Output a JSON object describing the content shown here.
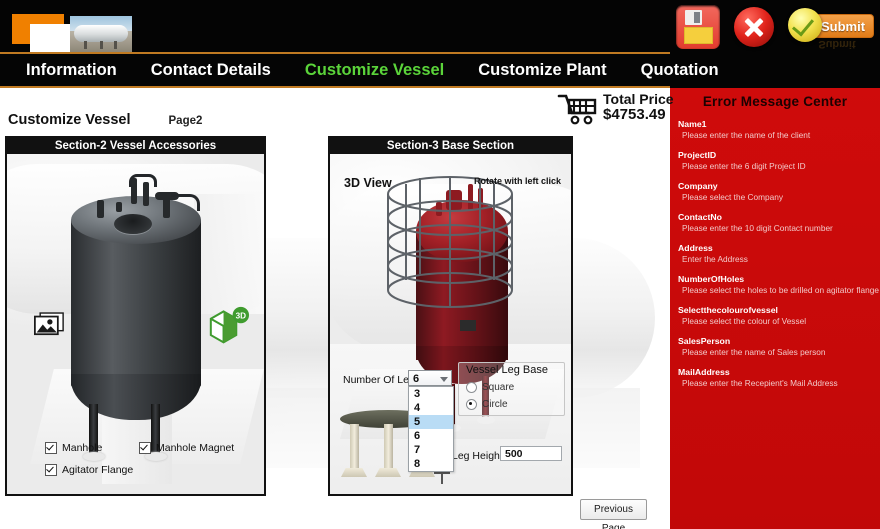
{
  "app": {
    "logo_alt": "vessel-company-logo"
  },
  "toolbar": {
    "save_label": "Save",
    "close_label": "Close",
    "submit_label": "Submit"
  },
  "nav": {
    "items": [
      {
        "label": "Information",
        "active": false
      },
      {
        "label": "Contact Details",
        "active": false
      },
      {
        "label": "Customize Vessel",
        "active": true
      },
      {
        "label": "Customize Plant",
        "active": false
      },
      {
        "label": "Quotation",
        "active": false
      }
    ],
    "active_color": "#5bd43a"
  },
  "page": {
    "title": "Customize Vessel",
    "page_number": "Page2"
  },
  "cart": {
    "label": "Total Price",
    "value": "$4753.49"
  },
  "panel_accessories": {
    "header": "Section-2 Vessel Accessories",
    "image_icon": "image-icon",
    "three_d_icon": "3D",
    "checkboxes": [
      {
        "label": "Manhole",
        "checked": true
      },
      {
        "label": "Manhole Magnet",
        "checked": true
      },
      {
        "label": "Agitator Flange",
        "checked": true
      }
    ]
  },
  "panel_base": {
    "header": "Section-3 Base Section",
    "view_label": "3D View",
    "rotate_hint": "Rotate with left click",
    "legs": {
      "label": "Number Of Legs",
      "value": "6",
      "options": [
        "3",
        "4",
        "5",
        "6",
        "7",
        "8"
      ],
      "highlighted": "5",
      "expanded": true
    },
    "leg_base": {
      "title": "Vessel Leg Base",
      "options": [
        {
          "label": "Square",
          "selected": false
        },
        {
          "label": "Circle",
          "selected": true
        }
      ]
    },
    "leg_height": {
      "label": "Leg Height",
      "value": "500"
    }
  },
  "footer": {
    "previous_page": "Previous Page"
  },
  "errors": {
    "title": "Error Message Center",
    "items": [
      {
        "field": "Name1",
        "message": "Please enter the name of the client"
      },
      {
        "field": "ProjectID",
        "message": "Please enter the 6 digit Project ID"
      },
      {
        "field": "Company",
        "message": "Please select the Company"
      },
      {
        "field": "ContactNo",
        "message": "Please enter the 10 digit Contact number"
      },
      {
        "field": "Address",
        "message": "Enter the Address"
      },
      {
        "field": "NumberOfHoles",
        "message": "Please select the holes to be drilled on agitator flange"
      },
      {
        "field": "Selectthecolourofvessel",
        "message": "Please select the colour of Vessel"
      },
      {
        "field": "SalesPerson",
        "message": "Please enter the name of Sales person"
      },
      {
        "field": "MailAddress",
        "message": "Please enter the Recepient's Mail Address"
      }
    ],
    "background_color": "#c60a0a"
  }
}
